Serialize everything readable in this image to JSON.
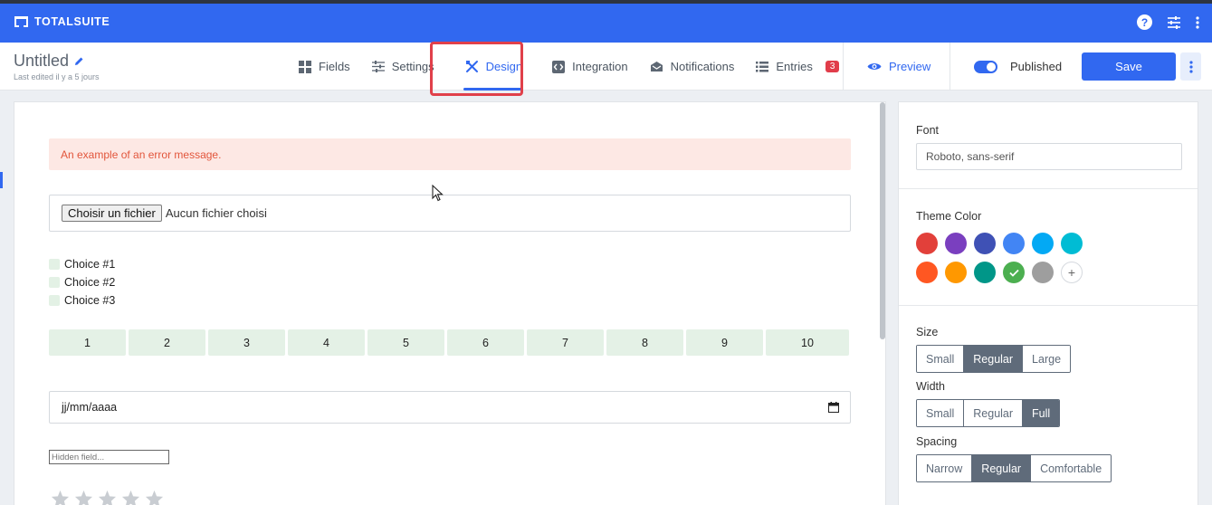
{
  "topbar": {
    "brand": "TOTALSUITE",
    "icons": [
      "help-icon",
      "sliders-icon",
      "more-vertical-icon"
    ]
  },
  "document": {
    "title": "Untitled",
    "subtitle": "Last edited il y a 5 jours"
  },
  "tabs": [
    {
      "label": "Fields",
      "icon": "grid-icon",
      "active": false
    },
    {
      "label": "Settings",
      "icon": "sliders-icon",
      "active": false
    },
    {
      "label": "Design",
      "icon": "design-tools-icon",
      "active": true
    },
    {
      "label": "Integration",
      "icon": "code-icon",
      "active": false
    },
    {
      "label": "Notifications",
      "icon": "inbox-icon",
      "active": false
    },
    {
      "label": "Entries",
      "icon": "list-icon",
      "active": false,
      "badge": "3"
    }
  ],
  "actions": {
    "preview_label": "Preview",
    "published_label": "Published",
    "published": true,
    "save_label": "Save"
  },
  "form": {
    "error_message": "An example of an error message.",
    "file_button_label": "Choisir un fichier",
    "file_status": "Aucun fichier choisi",
    "choices": [
      "Choice #1",
      "Choice #2",
      "Choice #3"
    ],
    "scale": [
      "1",
      "2",
      "3",
      "4",
      "5",
      "6",
      "7",
      "8",
      "9",
      "10"
    ],
    "date_placeholder": "jj/mm/aaaa",
    "hidden_field_placeholder": "Hidden field...",
    "rating_stars": 5
  },
  "design": {
    "font_label": "Font",
    "font_value": "Roboto, sans-serif",
    "theme_color_label": "Theme Color",
    "theme_colors": [
      "#e2403a",
      "#7a3fbf",
      "#3f51b5",
      "#4285f4",
      "#03a9f4",
      "#00bcd4",
      "#ff5722",
      "#ff9800",
      "#009688",
      "#4caf50",
      "#9e9e9e"
    ],
    "selected_color": "#4caf50",
    "size_label": "Size",
    "size_options": [
      "Small",
      "Regular",
      "Large"
    ],
    "size_selected": "Regular",
    "width_label": "Width",
    "width_options": [
      "Small",
      "Regular",
      "Full"
    ],
    "width_selected": "Full",
    "spacing_label": "Spacing",
    "spacing_options": [
      "Narrow",
      "Regular",
      "Comfortable"
    ],
    "spacing_selected": "Regular"
  },
  "colors": {
    "primary": "#3168f0",
    "error_text": "#e2553b",
    "error_bg": "#fde8e4",
    "badge": "#e13d4a",
    "highlight": "#e0404a"
  }
}
